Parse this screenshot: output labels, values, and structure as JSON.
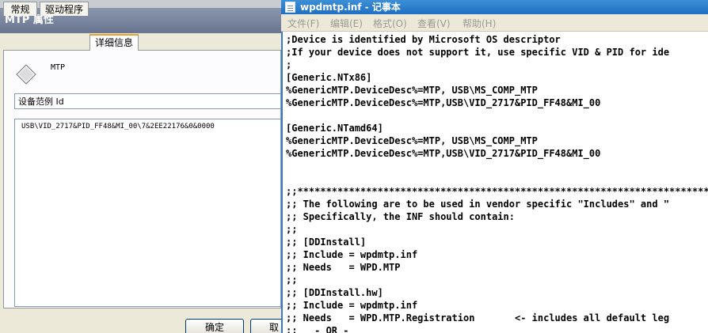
{
  "dialog": {
    "title": "MTP 属性",
    "tabs": [
      {
        "label": "常规"
      },
      {
        "label": "驱动程序"
      },
      {
        "label": "详细信息"
      }
    ],
    "device_name": "MTP",
    "property_select": "设备范例 Id",
    "property_value": "USB\\VID_2717&PID_FF48&MI_00\\7&2EE22176&0&0000",
    "buttons": {
      "ok": "确定",
      "cancel": "取"
    }
  },
  "notepad": {
    "title": "wpdmtp.inf - 记事本",
    "menu": [
      {
        "label": "文件(F)"
      },
      {
        "label": "编辑(E)"
      },
      {
        "label": "格式(O)"
      },
      {
        "label": "查看(V)"
      },
      {
        "label": "帮助(H)"
      }
    ],
    "lines": [
      ";Device is identified by Microsoft OS descriptor",
      ";If your device does not support it, use specific VID & PID for ide",
      ";",
      "[Generic.NTx86]",
      "%GenericMTP.DeviceDesc%=MTP, USB\\MS_COMP_MTP",
      "%GenericMTP.DeviceDesc%=MTP,USB\\VID_2717&PID_FF48&MI_00",
      "",
      "[Generic.NTamd64]",
      "%GenericMTP.DeviceDesc%=MTP, USB\\MS_COMP_MTP",
      "%GenericMTP.DeviceDesc%=MTP,USB\\VID_2717&PID_FF48&MI_00",
      "",
      "",
      ";;*************************************************************************",
      ";; The following are to be used in vendor specific \"Includes\" and \"",
      ";; Specifically, the INF should contain:",
      ";;",
      ";; [DDInstall]",
      ";; Include = wpdmtp.inf",
      ";; Needs   = WPD.MTP",
      ";;",
      ";; [DDInstall.hw]",
      ";; Include = wpdmtp.inf",
      ";; Needs   = WPD.MTP.Registration       <- includes all default leg",
      ";;   - OR -"
    ]
  }
}
